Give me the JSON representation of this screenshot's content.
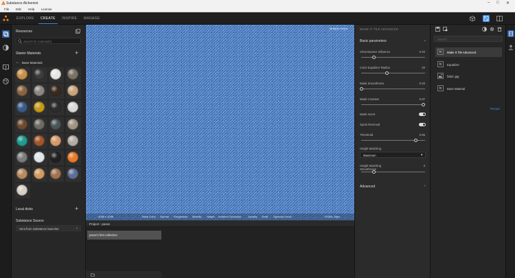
{
  "app": {
    "title": "Substance Alchemist",
    "accent": "#3b8be6",
    "brand_color": "#f08a24"
  },
  "menu": [
    "File",
    "Edit",
    "Help",
    "License"
  ],
  "nav_tabs": [
    {
      "label": "EXPLORE",
      "active": false
    },
    {
      "label": "CREATE",
      "active": true
    },
    {
      "label": "INSPIRE",
      "active": false
    },
    {
      "label": "MANAGE",
      "active": false
    }
  ],
  "left_panel": {
    "resources_title": "Resources",
    "search_placeholder": "Search for material(s)",
    "starter_title": "Starter Materials",
    "folder_label": "Base Materials",
    "local_disks": "Local disks",
    "substance_source": "Substance Source",
    "source_dropdown": "Sent from Substance launcher",
    "materials": [
      {
        "color": "#c8904a",
        "icon": "sand-material"
      },
      {
        "color": "#3c3c3c",
        "icon": "asphalt-material"
      },
      {
        "color": "#e6e6e2",
        "icon": "plaster-material"
      },
      {
        "color": "#7a7064",
        "icon": "stone-material"
      },
      {
        "color": "#8a6442",
        "icon": "bark-material"
      },
      {
        "color": "#8c8782",
        "icon": "concrete-material"
      },
      {
        "color": "#3a2a1c",
        "icon": "leather-material"
      },
      {
        "color": "#c9a57d",
        "icon": "wood-material"
      },
      {
        "color": "#3c5a86",
        "icon": "denim-material"
      },
      {
        "color": "#c39a18",
        "icon": "gold-material"
      },
      {
        "color": "#2d2d2d",
        "icon": "rubber-material"
      },
      {
        "color": "#d8d8d8",
        "icon": "marble-material"
      },
      {
        "color": "#6e4a2e",
        "icon": "soil-material"
      },
      {
        "color": "#6e6a64",
        "icon": "gravel-material"
      },
      {
        "color": "#4b5558",
        "icon": "slate-material"
      },
      {
        "color": "#9f9384",
        "icon": "cobble-material"
      },
      {
        "color": "#1f9b8f",
        "icon": "paint-material"
      },
      {
        "color": "#a0552a",
        "icon": "rust-material"
      },
      {
        "color": "#d49a6a",
        "icon": "skin-material"
      },
      {
        "color": "#b4aca2",
        "icon": "fabric-material"
      },
      {
        "color": "#7c7c7c",
        "icon": "metal-material"
      },
      {
        "color": "#e0e6ea",
        "icon": "snow-material"
      },
      {
        "color": "#202020",
        "icon": "carbon-material"
      },
      {
        "color": "#e87a2a",
        "icon": "plastic-material"
      },
      {
        "color": "#b58a5e",
        "icon": "cork-material"
      },
      {
        "color": "#d19a62",
        "icon": "clay-material"
      },
      {
        "color": "#a07452",
        "icon": "terracotta-material"
      },
      {
        "color": "#5e6f95",
        "icon": "tile-material"
      },
      {
        "color": "#d8d2c6",
        "icon": "linen-material"
      }
    ]
  },
  "viewport": {
    "corner_text": "Multiple Select",
    "size_label": "4096 x 4096",
    "channels": [
      "Base Color",
      "Normal",
      "Roughness",
      "Metallic",
      "Height",
      "Ambient Occlusion",
      "Opacity",
      "Scatt",
      "Specular Level"
    ],
    "format_label": "RGBA, 8bpc",
    "fabric_color": "#4a7bc0"
  },
  "project": {
    "title": "Project - paras",
    "collection": "paras's first collection"
  },
  "params": {
    "panel_title": "MAKE IT TILE ADVANCED",
    "section": "Basic parameters",
    "advanced": "Advanced",
    "sliders": [
      {
        "label": "Chrominance Influence",
        "value": "0.20",
        "pos": 0.2
      },
      {
        "label": "Color Equalizer Radius",
        "value": "20",
        "pos": 0.4
      },
      {
        "label": "Mask Smoothness",
        "value": "0.20",
        "pos": 0.0
      },
      {
        "label": "Mask Contrast",
        "value": "0.97",
        "pos": 0.97
      }
    ],
    "toggles": [
      {
        "label": "Mask Invert",
        "on": true
      },
      {
        "label": "Spots Removal",
        "on": true
      }
    ],
    "threshold": {
      "label": "Threshold",
      "value": "0.86",
      "pos": 0.86
    },
    "height_matching": {
      "label": "Height Matching",
      "value": "Maximum"
    },
    "height_smooth": {
      "label_line1": "Height Matching",
      "label_line2": "Smoothness",
      "value": "3",
      "pos": 0.2
    }
  },
  "stack": {
    "search_placeholder": "Search",
    "items": [
      {
        "label": "Make It Tile Advanced",
        "type": "fx",
        "selected": true
      },
      {
        "label": "Equalizer",
        "type": "fx",
        "selected": false
      },
      {
        "label": "fabric.jpg",
        "type": "image",
        "selected": false
      },
      {
        "label": "Base Material",
        "type": "fx",
        "selected": false
      }
    ],
    "reload": "Reload"
  }
}
